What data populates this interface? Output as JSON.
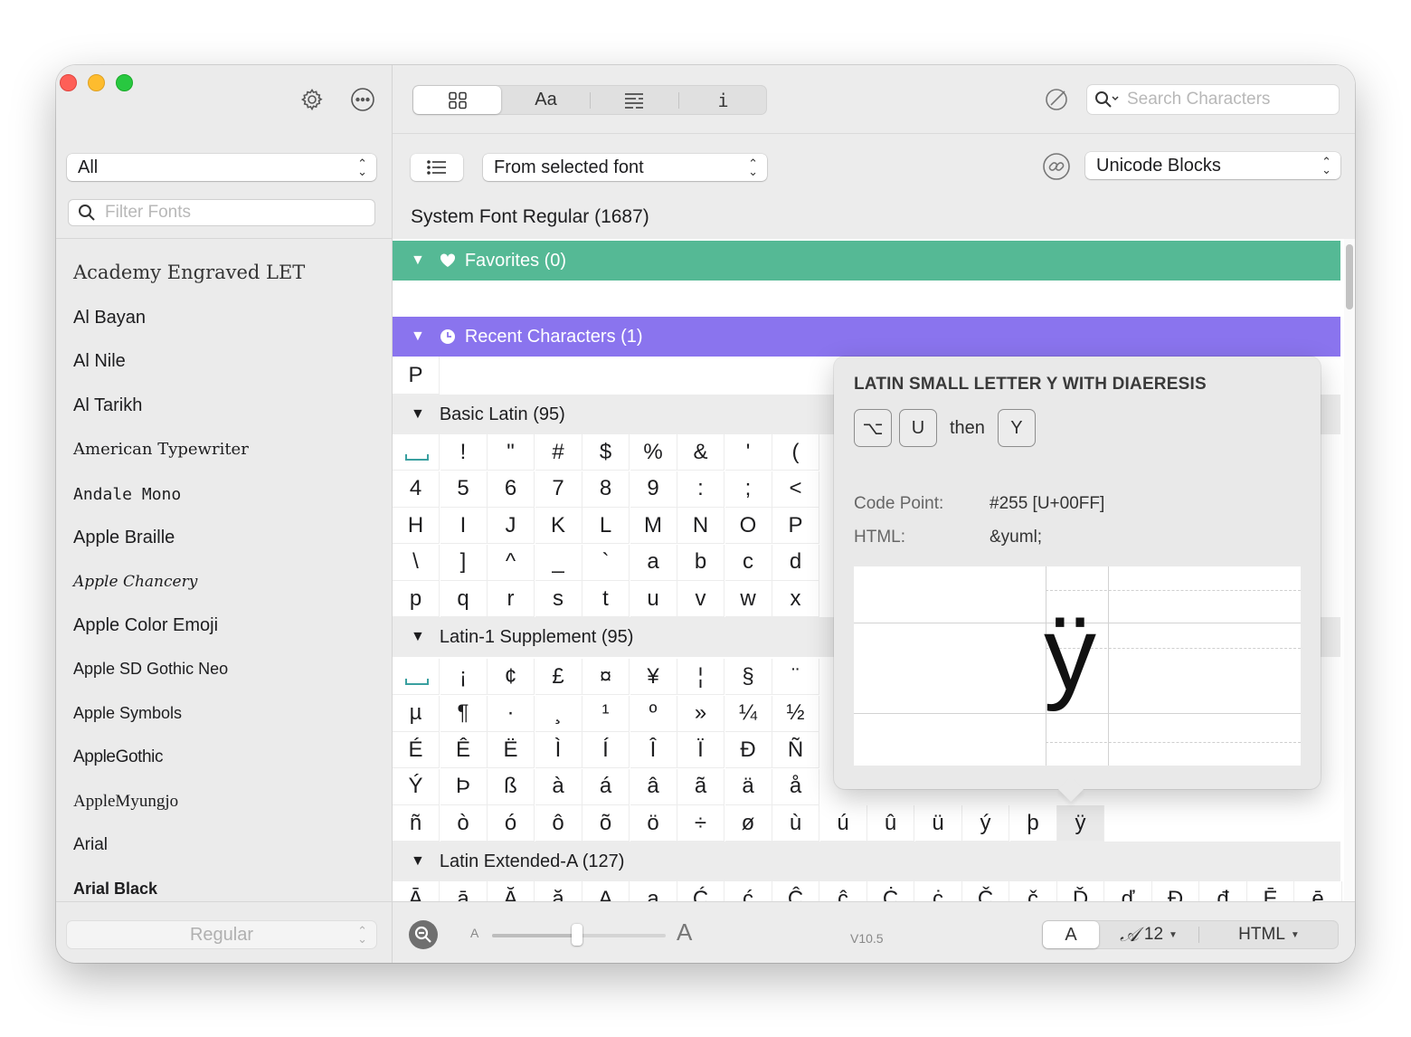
{
  "sidebar": {
    "category_filter": "All",
    "filter_placeholder": "Filter Fonts",
    "fonts": [
      "Academy Engraved LET",
      "Al Bayan",
      "Al Nile",
      "Al Tarikh",
      "American Typewriter",
      "Andale Mono",
      "Apple Braille",
      "Apple Chancery",
      "Apple Color Emoji",
      "Apple SD Gothic Neo",
      "Apple Symbols",
      "AppleGothic",
      "AppleMyungjo",
      "Arial",
      "Arial Black"
    ],
    "style_selector": "Regular"
  },
  "toolbar": {
    "view_tabs": [
      "grid",
      "Aa",
      "list",
      "i"
    ],
    "search_placeholder": "Search Characters"
  },
  "filter_bar": {
    "source": "From selected font",
    "grouping": "Unicode Blocks"
  },
  "font_title": "System Font Regular (1687)",
  "sections": {
    "favorites": "Favorites (0)",
    "recent": "Recent Characters (1)",
    "recent_chars": [
      "P"
    ],
    "basic_latin": "Basic Latin (95)",
    "basic_latin_rows": [
      [
        " ",
        "!",
        "\"",
        "#",
        "$",
        "%",
        "&",
        "'",
        "("
      ],
      [
        "4",
        "5",
        "6",
        "7",
        "8",
        "9",
        ":",
        ";",
        "<"
      ],
      [
        "H",
        "I",
        "J",
        "K",
        "L",
        "M",
        "N",
        "O",
        "P"
      ],
      [
        "\\",
        "]",
        "^",
        "_",
        "`",
        "a",
        "b",
        "c",
        "d"
      ],
      [
        "p",
        "q",
        "r",
        "s",
        "t",
        "u",
        "v",
        "w",
        "x"
      ]
    ],
    "latin1": "Latin-1 Supplement (95)",
    "latin1_rows": [
      [
        " ",
        "¡",
        "¢",
        "£",
        "¤",
        "¥",
        "¦",
        "§",
        "¨"
      ],
      [
        "µ",
        "¶",
        "·",
        "¸",
        "¹",
        "º",
        "»",
        "¼",
        "½"
      ],
      [
        "É",
        "Ê",
        "Ë",
        "Ì",
        "Í",
        "Î",
        "Ï",
        "Ð",
        "Ñ"
      ],
      [
        "Ý",
        "Þ",
        "ß",
        "à",
        "á",
        "â",
        "ã",
        "ä",
        "å"
      ],
      [
        "ñ",
        "ò",
        "ó",
        "ô",
        "õ",
        "ö",
        "÷",
        "ø",
        "ù",
        "ú",
        "û",
        "ü",
        "ý",
        "þ",
        "ÿ"
      ]
    ],
    "latin_ext_a": "Latin Extended-A (127)",
    "latin_ext_a_row": [
      "Ā",
      "ā",
      "Ă",
      "ă",
      "Ą",
      "ą",
      "Ć",
      "ć",
      "Ĉ",
      "ĉ",
      "Ċ",
      "ċ",
      "Č",
      "č",
      "Ď",
      "ď",
      "Đ",
      "đ",
      "Ē",
      "ē"
    ]
  },
  "popover": {
    "char_name": "LATIN SMALL LETTER Y WITH DIAERESIS",
    "keys": [
      "⌥",
      "U"
    ],
    "then": "then",
    "key_after": "Y",
    "code_point_label": "Code Point:",
    "code_point": "#255 [U+00FF]",
    "html_label": "HTML:",
    "html_entity": "&yuml;",
    "glyph": "ÿ"
  },
  "footer": {
    "small_a": "A",
    "large_a": "A",
    "size_slider_fraction": 0.49,
    "version": "V10.5",
    "preview_char": "A",
    "font_size": "12",
    "copy_format": "HTML"
  }
}
